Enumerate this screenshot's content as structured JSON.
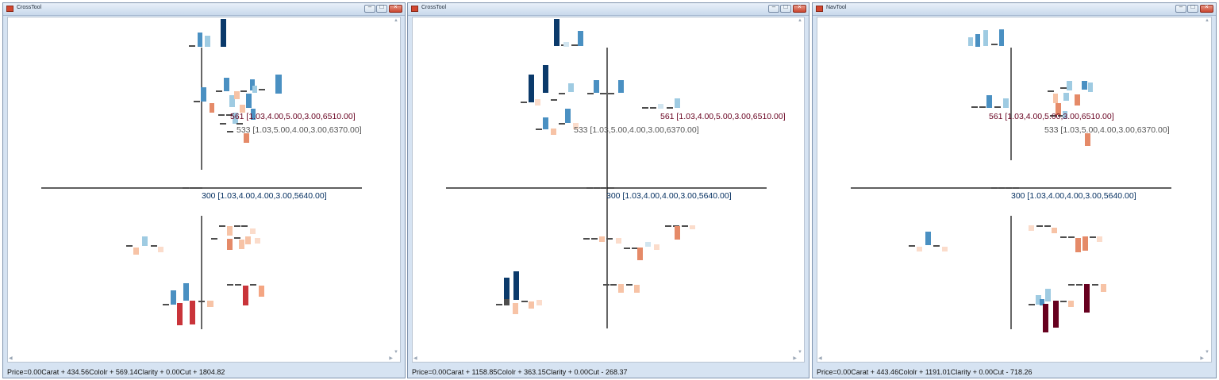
{
  "windows": [
    {
      "title": "CrossTool",
      "status": "Price=0.00Carat + 434.56Cololr + 569.14Clarity + 0.00Cut + 1804.82"
    },
    {
      "title": "CrossTool",
      "status": "Price=0.00Carat + 1158.85Cololr + 363.15Clarity + 0.00Cut - 268.37"
    },
    {
      "title": "NavTool",
      "status": "Price=0.00Carat + 443.46Cololr + 1191.01Clarity + 0.00Cut - 718.26"
    }
  ],
  "labels": {
    "p561": "561 [1.03,4.00,5.00,3.00,6510.00]",
    "p533": "533 [1.03,5.00,4.00,3.00,6370.00]",
    "p300": "300 [1.03,4.00,4.00,3.00,5640.00]"
  },
  "label_colors": {
    "p561": "#67001f",
    "p533": "#555555",
    "p300": "#053061"
  },
  "window_controls": {
    "minimize": "minimize-icon",
    "maximize": "maximize-icon",
    "close": "close-icon"
  },
  "palette": {
    "dark_blue": "#0b3a6b",
    "mid_blue": "#4a90c2",
    "light_blue": "#9fcbe2",
    "pale_blue": "#d1e5f0",
    "pale_orange": "#f7c3a6",
    "orange": "#e58a68",
    "red": "#c9343a",
    "dark_red": "#67001f",
    "segment_gray": "#4d4d4d"
  }
}
